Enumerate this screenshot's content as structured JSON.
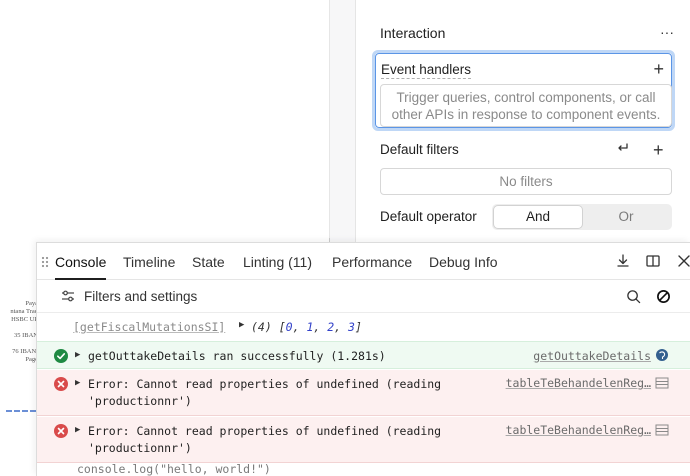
{
  "canvas": {
    "doc_lines": [
      "Paya",
      "ntana Trad",
      "HSBC UP",
      "",
      "35 IBAN",
      "",
      "76 IBAN:",
      "Page"
    ]
  },
  "inspector": {
    "title": "Interaction",
    "event_handlers": {
      "label": "Event handlers",
      "placeholder": "Trigger queries, control components, or call other APIs in response to component events."
    },
    "default_filters": {
      "label": "Default filters",
      "empty_text": "No filters"
    },
    "default_operator": {
      "label": "Default operator",
      "options": [
        "And",
        "Or"
      ],
      "selected": "And"
    }
  },
  "console": {
    "tabs": [
      {
        "label": "Console",
        "active": true
      },
      {
        "label": "Timeline",
        "active": false
      },
      {
        "label": "State",
        "active": false
      },
      {
        "label": "Linting (11)",
        "active": false
      },
      {
        "label": "Performance",
        "active": false
      },
      {
        "label": "Debug Info",
        "active": false
      }
    ],
    "filter_label": "Filters and settings",
    "entries": {
      "array": {
        "name": "[getFiscalMutationsSI]",
        "count": "(4)",
        "values": [
          "0",
          "1",
          "2",
          "3"
        ]
      },
      "success": {
        "message": "getOuttakeDetails ran successfully (1.281s)",
        "source": "getOuttakeDetails",
        "status": "success"
      },
      "error1": {
        "message": "Error: Cannot read properties of undefined (reading 'productionnr')",
        "source": "tableTeBehandelenReg…",
        "status": "error"
      },
      "error2": {
        "message": "Error: Cannot read properties of undefined (reading 'productionnr')",
        "source": "tableTeBehandelenReg…",
        "status": "error"
      },
      "input_preview": "console.log(\"hello, world!\")"
    },
    "colors": {
      "success": "#1f8a43",
      "error": "#d94b4b",
      "number": "#3342c9",
      "focus_ring": "#5b95e6"
    }
  }
}
